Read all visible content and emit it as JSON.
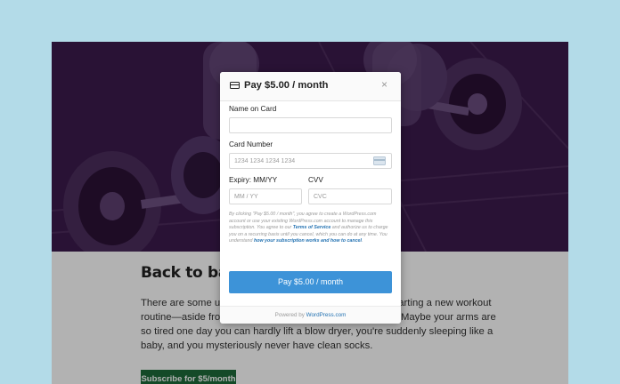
{
  "page": {
    "background": "#b3dbe8",
    "hero_tint": "#3b1a4c"
  },
  "article": {
    "title": "Back to basics",
    "body": "There are some unexpected side effects that come with starting a new workout routine—aside from weight loss and improved endurance. Maybe your arms are so tired one day you can hardly lift a blow dryer, you're suddenly sleeping like a baby, and you mysteriously never have clean socks.",
    "subscribe_label": "Subscribe for $5/month"
  },
  "modal": {
    "title": "Pay $5.00 / month",
    "close_symbol": "×",
    "name_label": "Name on Card",
    "name_value": "",
    "card_number_label": "Card Number",
    "card_number_placeholder": "1234 1234 1234 1234",
    "expiry_label": "Expiry: MM/YY",
    "expiry_placeholder": "MM / YY",
    "cvv_label": "CVV",
    "cvv_placeholder": "CVC",
    "terms_intro": "By clicking \"Pay $5.00 / month\", you agree to create a WordPress.com account or use your existing WordPress.com account to manage this subscription. You agree to our ",
    "terms_link": "Terms of Service",
    "terms_middle": " and authorize us to charge you on a recurring basis until you cancel, which you can do at any time. You understand ",
    "terms_link2": "how your subscription works and how to cancel",
    "terms_end": ".",
    "pay_button": "Pay $5.00 / month",
    "footer_prefix": "Powered by ",
    "footer_brand": "WordPress.com",
    "accent": "#3d93d8",
    "link_color": "#2271b1"
  },
  "icons": {
    "title_icon": "credit-card-icon",
    "close_icon": "close-icon",
    "card_field_icon": "card-brand-icon"
  }
}
